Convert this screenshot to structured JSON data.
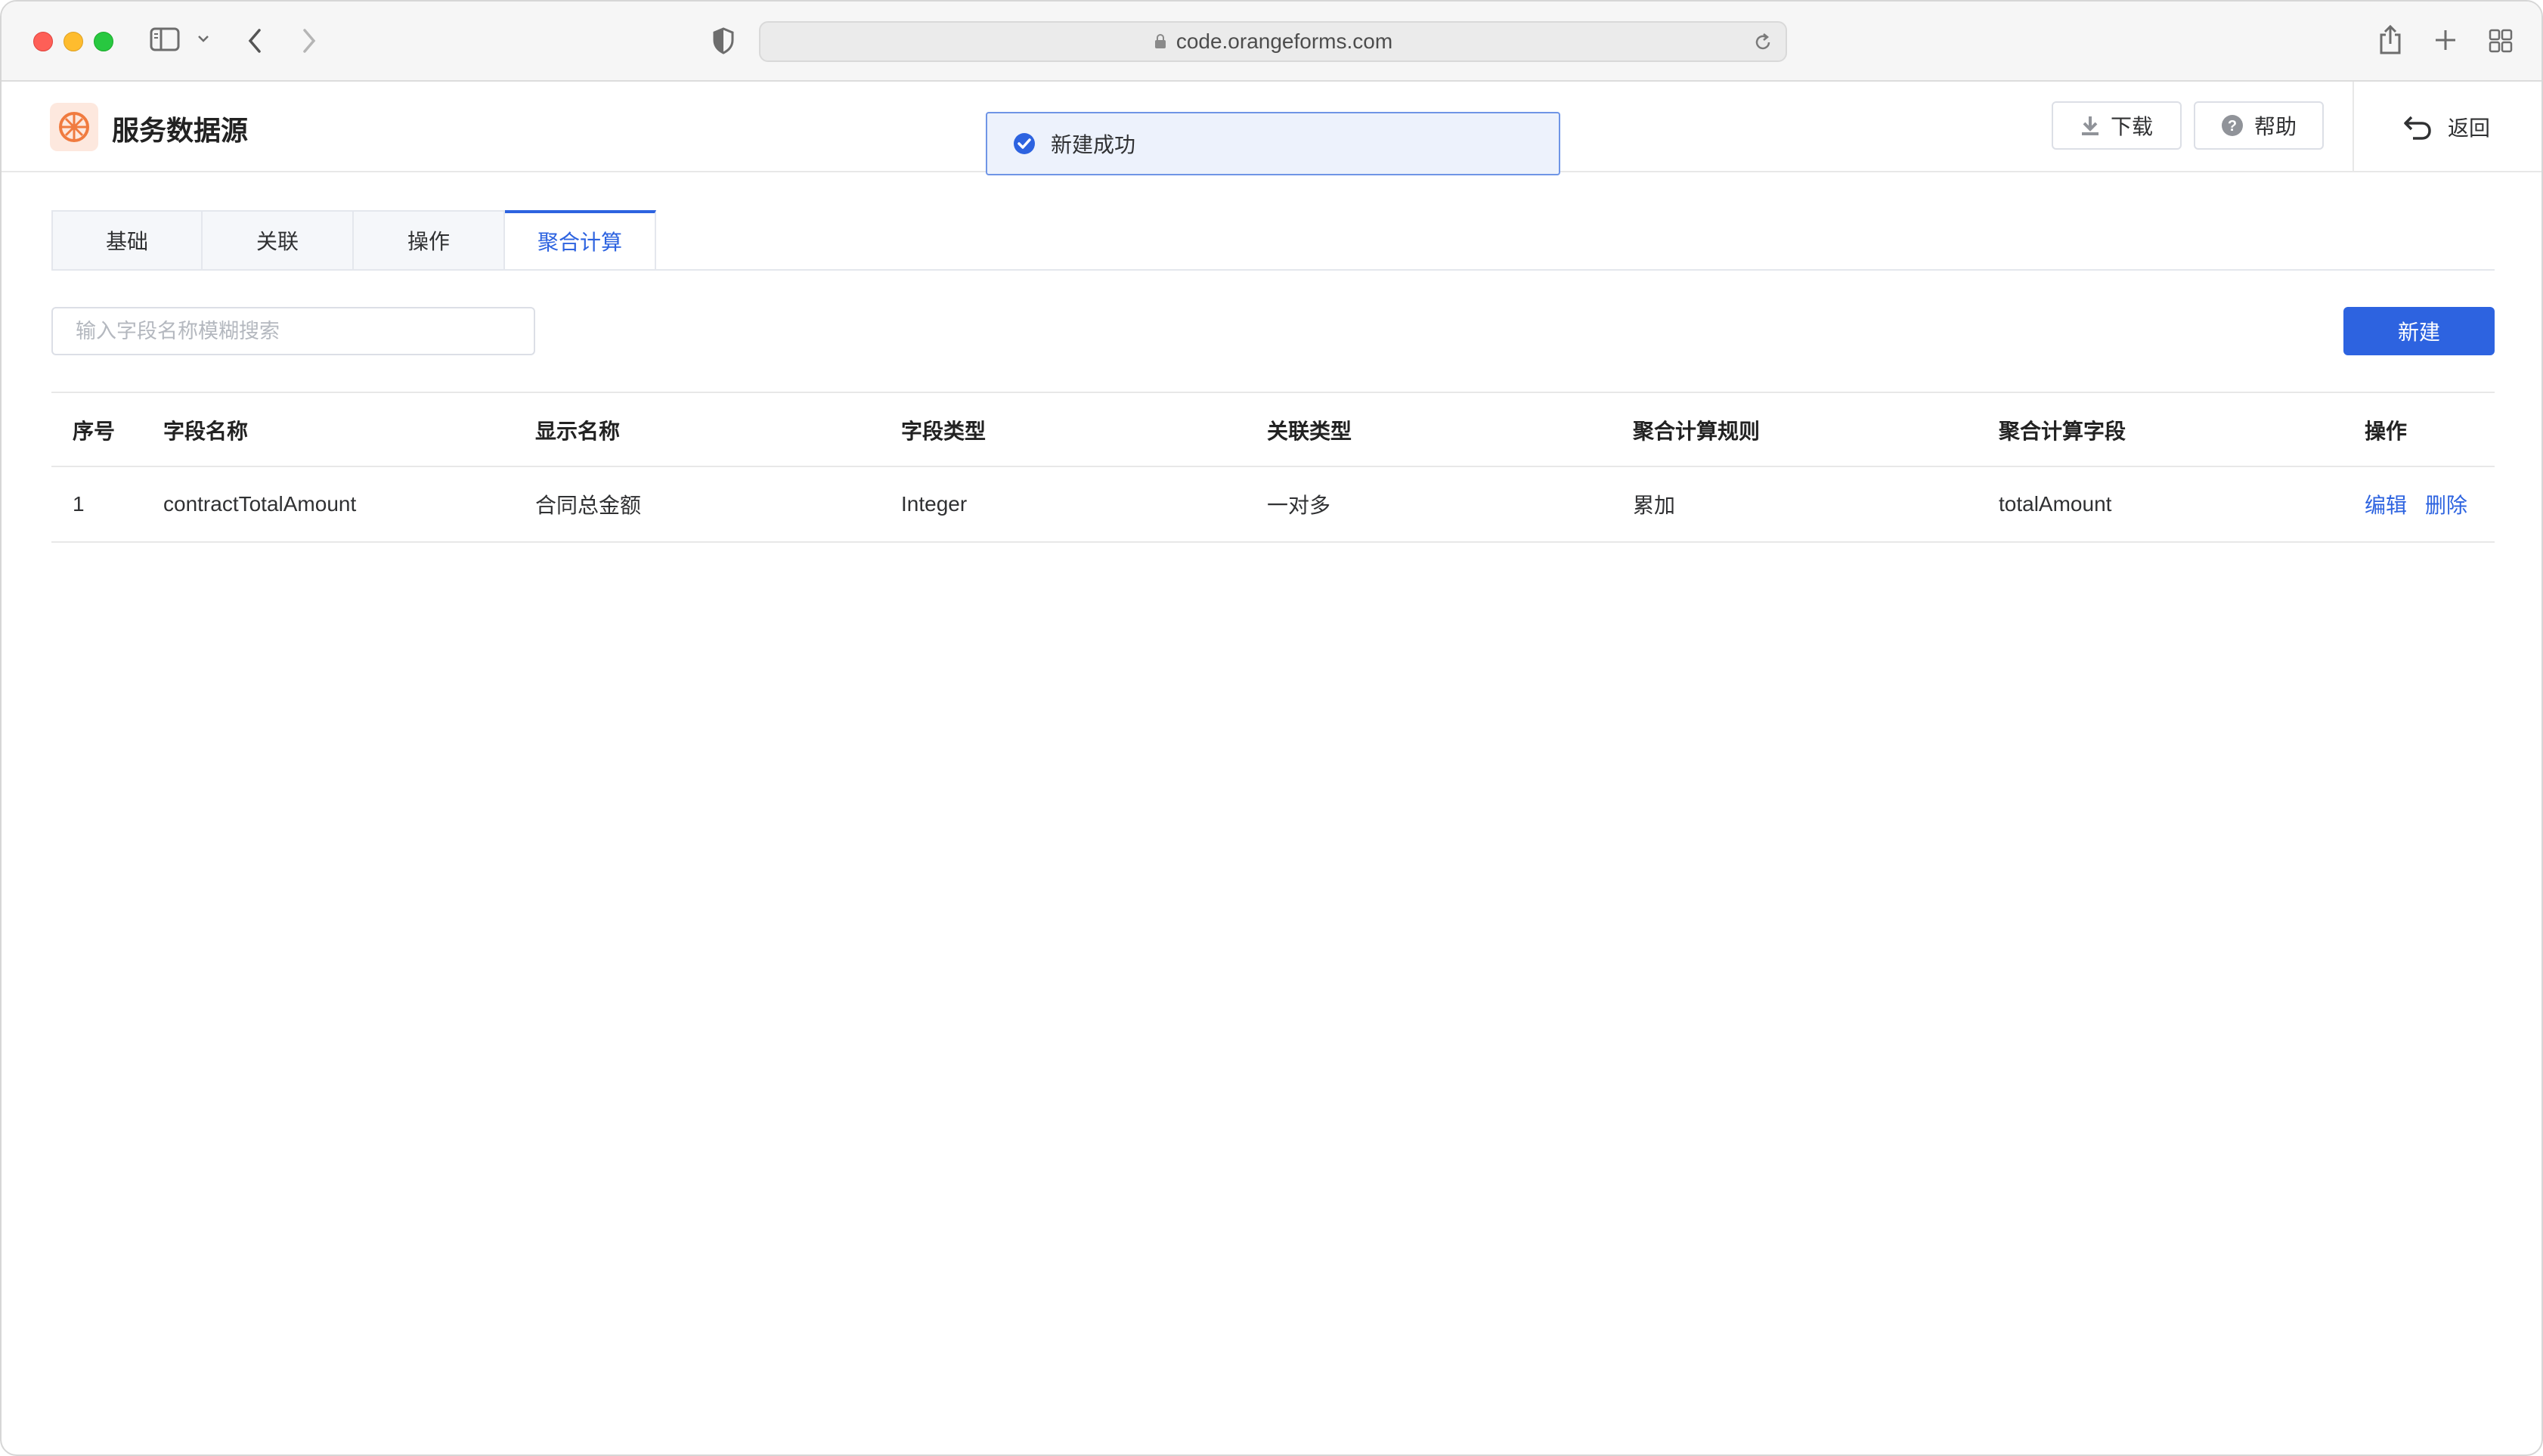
{
  "browser": {
    "url": "code.orangeforms.com"
  },
  "header": {
    "title": "服务数据源",
    "download_label": "下载",
    "help_label": "帮助",
    "back_label": "返回"
  },
  "toast": {
    "message": "新建成功"
  },
  "tabs": [
    {
      "label": "基础",
      "active": false
    },
    {
      "label": "关联",
      "active": false
    },
    {
      "label": "操作",
      "active": false
    },
    {
      "label": "聚合计算",
      "active": true
    }
  ],
  "search": {
    "placeholder": "输入字段名称模糊搜索",
    "value": ""
  },
  "new_button_label": "新建",
  "table": {
    "columns": [
      "序号",
      "字段名称",
      "显示名称",
      "字段类型",
      "关联类型",
      "聚合计算规则",
      "聚合计算字段",
      "操作"
    ],
    "rows": [
      {
        "index": "1",
        "field_name": "contractTotalAmount",
        "display_name": "合同总金额",
        "field_type": "Integer",
        "relation_type": "一对多",
        "agg_rule": "累加",
        "agg_field": "totalAmount",
        "edit_label": "编辑",
        "delete_label": "删除"
      }
    ]
  },
  "colors": {
    "primary": "#2d63e0",
    "toast_border": "#6f95e6",
    "logo_orange": "#f07b3f"
  }
}
